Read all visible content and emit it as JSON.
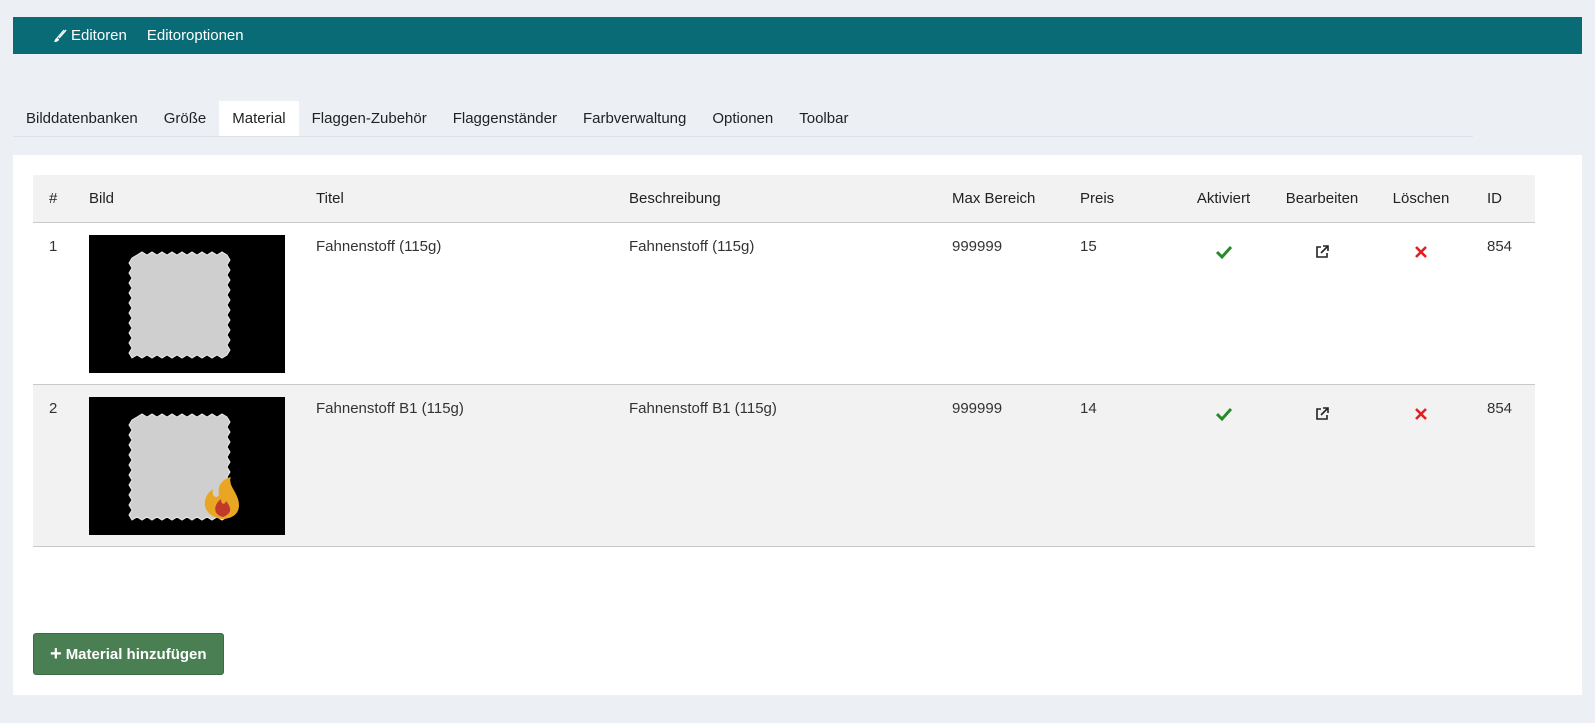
{
  "topbar": {
    "items": [
      {
        "label": "Editoren",
        "icon": "brush-icon"
      },
      {
        "label": "Editoroptionen"
      }
    ],
    "background": "#086b76"
  },
  "tabs": [
    {
      "label": "Bilddatenbanken",
      "active": false
    },
    {
      "label": "Größe",
      "active": false
    },
    {
      "label": "Material",
      "active": true
    },
    {
      "label": "Flaggen-Zubehör",
      "active": false
    },
    {
      "label": "Flaggenständer",
      "active": false
    },
    {
      "label": "Farbverwaltung",
      "active": false
    },
    {
      "label": "Optionen",
      "active": false
    },
    {
      "label": "Toolbar",
      "active": false
    }
  ],
  "table": {
    "columns": [
      "#",
      "Bild",
      "Titel",
      "Beschreibung",
      "Max Bereich",
      "Preis",
      "Aktiviert",
      "Bearbeiten",
      "Löschen",
      "ID"
    ],
    "rows": [
      {
        "num": "1",
        "image": "fabric-swatch",
        "title": "Fahnenstoff (115g)",
        "description": "Fahnenstoff (115g)",
        "max_range": "999999",
        "price": "15",
        "activated": "check-icon",
        "edit": "external-link-icon",
        "delete": "close-icon",
        "id": "854"
      },
      {
        "num": "2",
        "image": "fabric-swatch-fire",
        "title": "Fahnenstoff B1 (115g)",
        "description": "Fahnenstoff B1 (115g)",
        "max_range": "999999",
        "price": "14",
        "activated": "check-icon",
        "edit": "external-link-icon",
        "delete": "close-icon",
        "id": "854"
      }
    ]
  },
  "add_button": {
    "label": "Material hinzufügen",
    "icon": "plus-icon",
    "color": "#4a7f53"
  },
  "colors": {
    "check": "#2a8a2a",
    "delete": "#e02020"
  }
}
